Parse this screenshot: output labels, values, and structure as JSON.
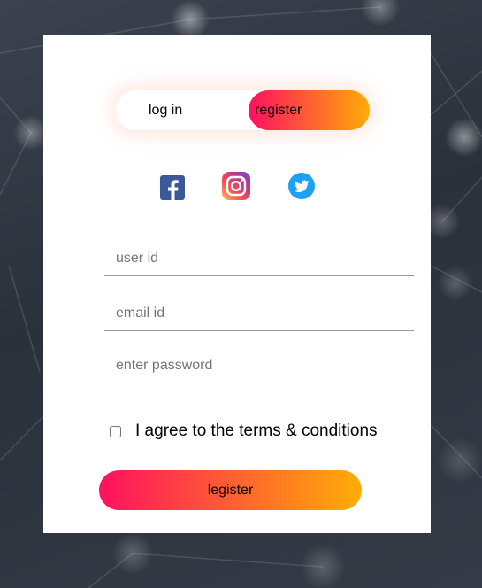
{
  "toggle": {
    "login_label": "log in",
    "register_label": "register",
    "active": "register"
  },
  "social": {
    "icons": [
      "facebook-icon",
      "instagram-icon",
      "twitter-icon"
    ]
  },
  "form": {
    "user_id_placeholder": "user id",
    "email_placeholder": "email id",
    "password_placeholder": "enter password",
    "terms_label": "I agree to the terms & conditions",
    "terms_checked": false,
    "submit_label": "legister"
  },
  "colors": {
    "gradient_start": "#ff105f",
    "gradient_end": "#ffad06",
    "facebook": "#3b5998",
    "twitter": "#1da1f2",
    "card_background": "#ffffff"
  }
}
